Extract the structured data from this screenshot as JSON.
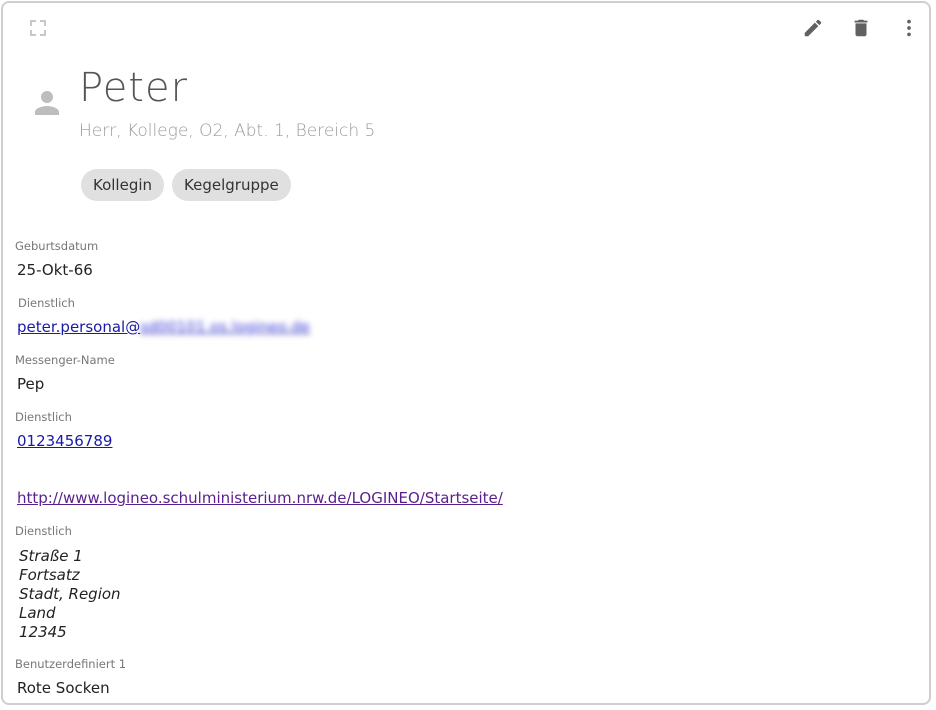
{
  "toolbar": {
    "expand_icon": "fullscreen-icon",
    "edit_icon": "pencil-icon",
    "delete_icon": "trash-icon",
    "more_icon": "more-vert-icon"
  },
  "contact": {
    "avatar_icon": "person-icon",
    "name": "Peter",
    "subtitle": "Herr, Kollege, O2, Abt. 1, Bereich 5",
    "tags": [
      "Kollegin",
      "Kegelgruppe"
    ]
  },
  "fields": {
    "birthday": {
      "label": "Geburtsdatum",
      "value": "25-Okt-66"
    },
    "email": {
      "label": "Dienstlich",
      "local": "peter.personal@",
      "domain_blurred": "sd00101.os.logineo.de"
    },
    "messenger": {
      "label": "Messenger-Name",
      "value": "Pep"
    },
    "phone": {
      "label": "Dienstlich",
      "value": "0123456789"
    },
    "website": {
      "value": "http://www.logineo.schulministerium.nrw.de/LOGINEO/Startseite/"
    },
    "address": {
      "label": "Dienstlich",
      "lines": [
        "Straße 1",
        "Fortsatz",
        "Stadt, Region",
        "Land",
        "12345"
      ]
    },
    "custom1": {
      "label": "Benutzerdefiniert 1",
      "value": "Rote Socken"
    }
  },
  "colors": {
    "icon": "#616161",
    "icon_light": "#bdbdbd",
    "chip_bg": "#e0e0e0",
    "link": "#1a1aa8",
    "link_visited": "#5a1f8f"
  }
}
